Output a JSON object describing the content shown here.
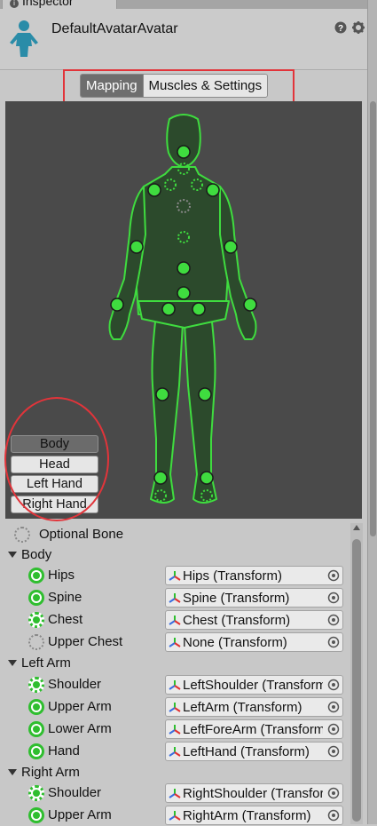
{
  "tab": {
    "label": "Inspector"
  },
  "header": {
    "title": "DefaultAvatarAvatar"
  },
  "mode_tabs": [
    {
      "label": "Mapping",
      "active": true
    },
    {
      "label": "Muscles & Settings",
      "active": false
    }
  ],
  "body_parts": [
    {
      "label": "Body",
      "selected": true
    },
    {
      "label": "Head",
      "selected": false
    },
    {
      "label": "Left Hand",
      "selected": false
    },
    {
      "label": "Right Hand",
      "selected": false
    }
  ],
  "legend": {
    "optional_bone": "Optional Bone"
  },
  "groups": {
    "body": "Body",
    "left_arm": "Left Arm",
    "right_arm": "Right Arm"
  },
  "bones": {
    "hips": {
      "label": "Hips",
      "value": "Hips (Transform)",
      "state": "required"
    },
    "spine": {
      "label": "Spine",
      "value": "Spine (Transform)",
      "state": "required"
    },
    "chest": {
      "label": "Chest",
      "value": "Chest (Transform)",
      "state": "optional-assigned"
    },
    "upper_chest": {
      "label": "Upper Chest",
      "value": "None (Transform)",
      "state": "optional-empty"
    },
    "l_shoulder": {
      "label": "Shoulder",
      "value": "LeftShoulder (Transform)",
      "state": "optional-assigned"
    },
    "l_upper_arm": {
      "label": "Upper Arm",
      "value": "LeftArm (Transform)",
      "state": "required"
    },
    "l_lower_arm": {
      "label": "Lower Arm",
      "value": "LeftForeArm (Transform)",
      "state": "required"
    },
    "l_hand": {
      "label": "Hand",
      "value": "LeftHand (Transform)",
      "state": "required"
    },
    "r_shoulder": {
      "label": "Shoulder",
      "value": "RightShoulder (Transform)",
      "state": "optional-assigned"
    },
    "r_upper_arm": {
      "label": "Upper Arm",
      "value": "RightArm (Transform)",
      "state": "required"
    }
  },
  "colors": {
    "accent_green": "#2fbe2f",
    "highlight_red": "#e2343a",
    "figure_fill": "#2c4a2c"
  },
  "icons": [
    "info-icon",
    "avatar-icon",
    "help-icon",
    "gear-icon",
    "transform-icon",
    "object-picker-icon",
    "foldout-caret-icon"
  ]
}
